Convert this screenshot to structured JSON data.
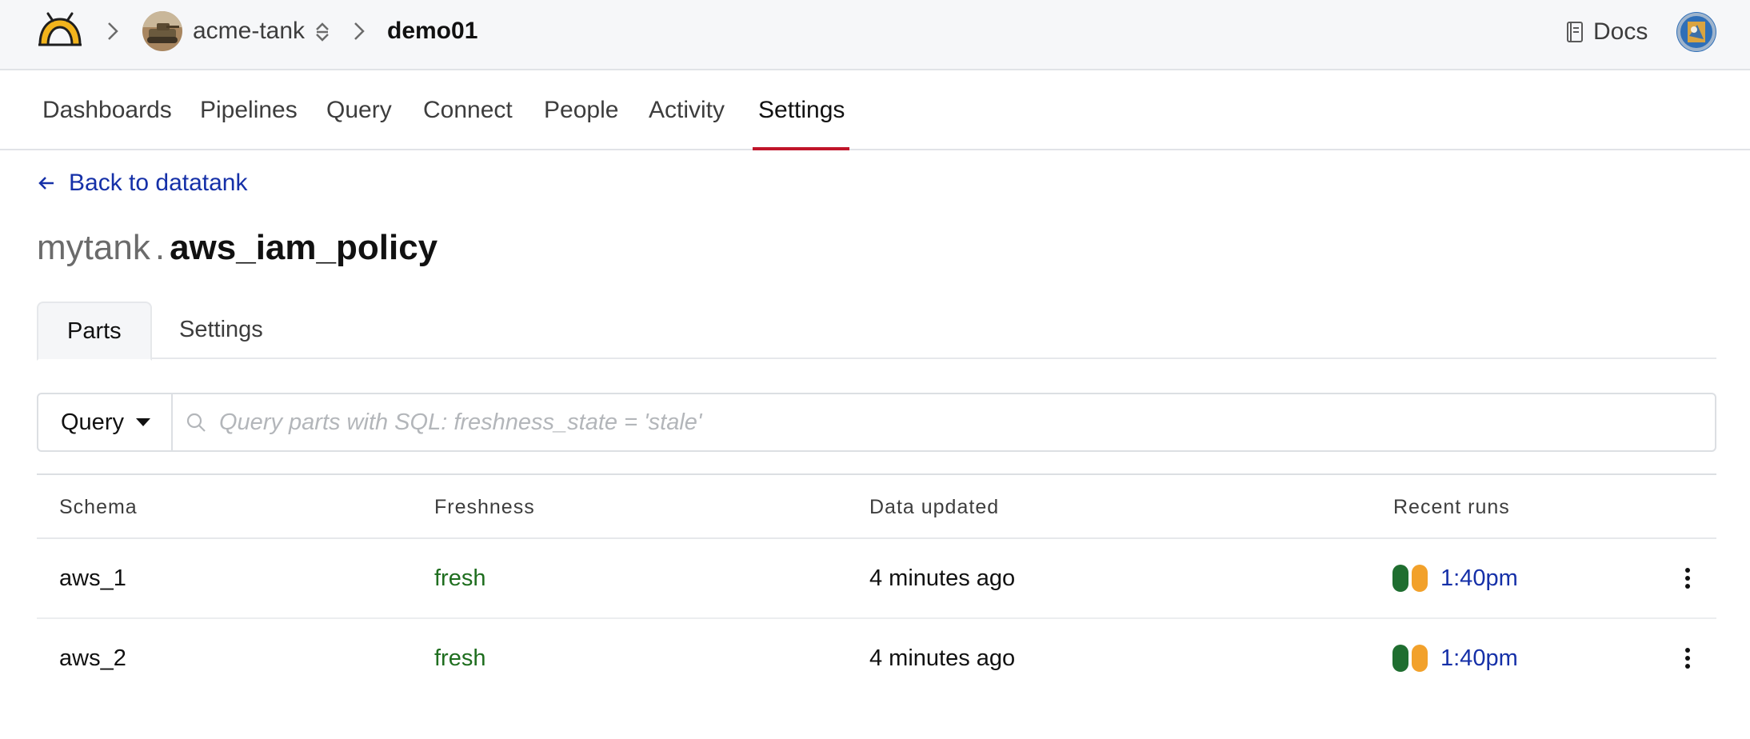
{
  "header": {
    "org": {
      "name": "acme-tank"
    },
    "project": {
      "name": "demo01"
    },
    "docs_label": "Docs"
  },
  "nav": {
    "tabs": [
      {
        "label": "Dashboards",
        "active": false
      },
      {
        "label": "Pipelines",
        "active": false
      },
      {
        "label": "Query",
        "active": false
      },
      {
        "label": "Connect",
        "active": false
      },
      {
        "label": "People",
        "active": false
      },
      {
        "label": "Activity",
        "active": false
      },
      {
        "label": "Settings",
        "active": true
      }
    ],
    "accent_color": "#c0152a"
  },
  "back_link": {
    "label": "Back to datatank"
  },
  "page_title": {
    "namespace": "mytank",
    "separator": ".",
    "table": "aws_iam_policy"
  },
  "subtabs": [
    {
      "label": "Parts",
      "active": true
    },
    {
      "label": "Settings",
      "active": false
    }
  ],
  "query_bar": {
    "mode_label": "Query",
    "placeholder": "Query parts with SQL: freshness_state = 'stale'",
    "value": ""
  },
  "table": {
    "columns": [
      "Schema",
      "Freshness",
      "Data updated",
      "Recent runs"
    ],
    "rows": [
      {
        "schema": "aws_1",
        "freshness": "fresh",
        "data_updated": "4 minutes ago",
        "run_statuses": [
          "success",
          "warning"
        ],
        "last_run": "1:40pm"
      },
      {
        "schema": "aws_2",
        "freshness": "fresh",
        "data_updated": "4 minutes ago",
        "run_statuses": [
          "success",
          "warning"
        ],
        "last_run": "1:40pm"
      }
    ]
  },
  "colors": {
    "link": "#1530a8",
    "fresh": "#1f6e1f",
    "run_success": "#1f6e30",
    "run_warning": "#f2a12b"
  }
}
